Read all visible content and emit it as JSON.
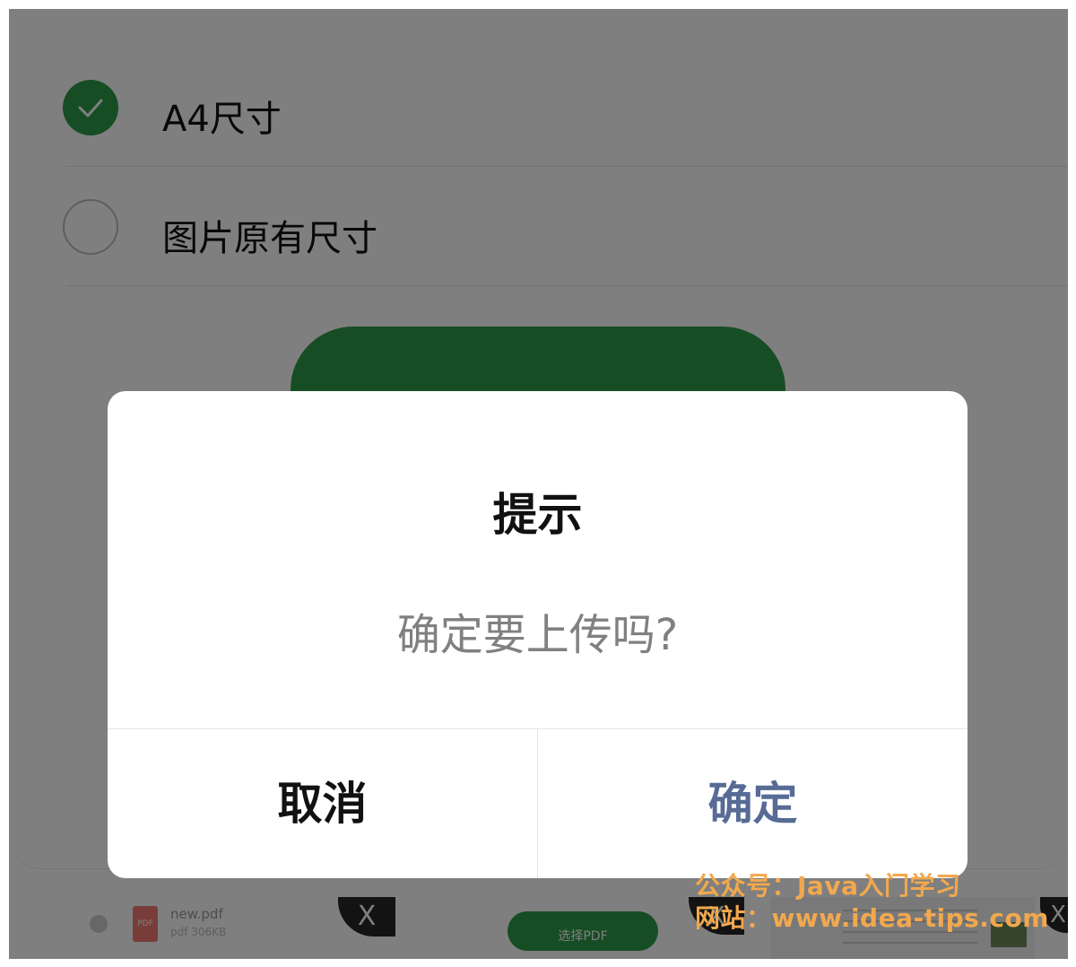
{
  "options": [
    {
      "label": "A4尺寸",
      "selected": true
    },
    {
      "label": "图片原有尺寸",
      "selected": false
    }
  ],
  "colors": {
    "accent_green": "#2e9a48",
    "link_blue": "#576b95",
    "overlay": "rgba(0,0,0,0.5)",
    "watermark": "#f2a84e"
  },
  "bottom_bar": {
    "file_name": "new.pdf",
    "file_meta": "pdf 306KB",
    "file_thumb_label": "PDF",
    "close_label": "X",
    "select_label": "选择PDF"
  },
  "dialog": {
    "title": "提示",
    "message": "确定要上传吗?",
    "cancel_label": "取消",
    "confirm_label": "确定"
  },
  "watermark": {
    "line1": "公众号：Java入门学习",
    "line2": "网站：www.idea-tips.com"
  }
}
